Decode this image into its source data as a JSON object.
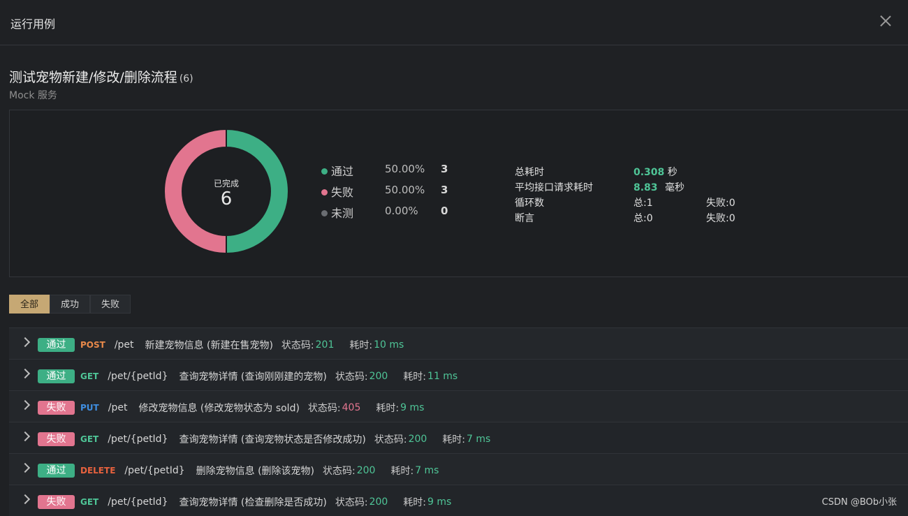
{
  "header": {
    "title": "运行用例"
  },
  "case": {
    "title": "测试宠物新建/修改/删除流程",
    "count": "(6)",
    "subtitle": "Mock 服务"
  },
  "summary": {
    "donut_label": "已完成",
    "donut_value": "6",
    "legend": [
      {
        "name": "通过",
        "percent": "50.00%",
        "count": "3",
        "color": "#3daf85"
      },
      {
        "name": "失败",
        "percent": "50.00%",
        "count": "3",
        "color": "#e2758f"
      },
      {
        "name": "未测",
        "percent": "0.00%",
        "count": "0",
        "color": "#6a6d72"
      }
    ],
    "stats": {
      "total_time_label": "总耗时",
      "total_time_value": "0.308",
      "total_time_unit": "秒",
      "avg_label": "平均接口请求耗时",
      "avg_value": "8.83",
      "avg_unit": "毫秒",
      "loop_label": "循环数",
      "loop_total": "总:1",
      "loop_fail": "失败:0",
      "assert_label": "断言",
      "assert_total": "总:0",
      "assert_fail": "失败:0"
    }
  },
  "filters": [
    "全部",
    "成功",
    "失败"
  ],
  "colors": {
    "pass": "#3daf85",
    "fail": "#e2758f",
    "POST": "#e8894a",
    "GET": "#4fc597",
    "PUT": "#3f8ee0",
    "DELETE": "#e8623e",
    "code_ok": "#4fc597",
    "code_err": "#e2758f",
    "time": "#4fc597"
  },
  "rows": [
    {
      "status": "通过",
      "status_kind": "pass",
      "method": "POST",
      "path": "/pet",
      "desc": "新建宠物信息 (新建在售宠物)",
      "code_label": "状态码:",
      "code": "201",
      "time_label": "耗时:",
      "time": "10 ms"
    },
    {
      "status": "通过",
      "status_kind": "pass",
      "method": "GET",
      "path": "/pet/{petId}",
      "desc": "查询宠物详情 (查询刚刚建的宠物)",
      "code_label": "状态码:",
      "code": "200",
      "time_label": "耗时:",
      "time": "11 ms"
    },
    {
      "status": "失败",
      "status_kind": "fail",
      "method": "PUT",
      "path": "/pet",
      "desc": "修改宠物信息 (修改宠物状态为 sold)",
      "code_label": "状态码:",
      "code": "405",
      "time_label": "耗时:",
      "time": "9 ms"
    },
    {
      "status": "失败",
      "status_kind": "fail",
      "method": "GET",
      "path": "/pet/{petId}",
      "desc": "查询宠物详情 (查询宠物状态是否修改成功)",
      "code_label": "状态码:",
      "code": "200",
      "time_label": "耗时:",
      "time": "7 ms"
    },
    {
      "status": "通过",
      "status_kind": "pass",
      "method": "DELETE",
      "path": "/pet/{petId}",
      "desc": "删除宠物信息 (删除该宠物)",
      "code_label": "状态码:",
      "code": "200",
      "time_label": "耗时:",
      "time": "7 ms"
    },
    {
      "status": "失败",
      "status_kind": "fail",
      "method": "GET",
      "path": "/pet/{petId}",
      "desc": "查询宠物详情 (检查删除是否成功)",
      "code_label": "状态码:",
      "code": "200",
      "time_label": "耗时:",
      "time": "9 ms"
    }
  ],
  "watermark": "CSDN @BOb小张"
}
